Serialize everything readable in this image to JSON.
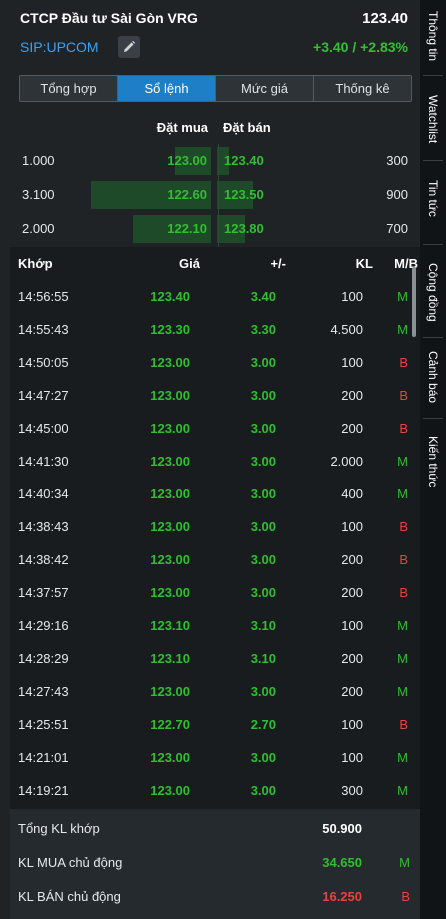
{
  "header": {
    "company": "CTCP Đầu tư Sài Gòn VRG",
    "price": "123.40",
    "ticker": "SIP:UPCOM",
    "change": "+3.40 / +2.83%"
  },
  "tabs": [
    {
      "label": "Tổng hợp"
    },
    {
      "label": "Sổ lệnh"
    },
    {
      "label": "Mức giá"
    },
    {
      "label": "Thống kê"
    }
  ],
  "orderbook": {
    "buy_label": "Đặt mua",
    "sell_label": "Đặt bán",
    "rows": [
      {
        "bid_qty": "1.000",
        "bid_price": "123.00",
        "ask_price": "123.40",
        "ask_qty": "300"
      },
      {
        "bid_qty": "3.100",
        "bid_price": "122.60",
        "ask_price": "123.50",
        "ask_qty": "900"
      },
      {
        "bid_qty": "2.000",
        "bid_price": "122.10",
        "ask_price": "123.80",
        "ask_qty": "700"
      }
    ],
    "bid_depth": [
      0.3,
      1.0,
      0.65
    ],
    "ask_depth": [
      0.1,
      0.3,
      0.23
    ]
  },
  "trades": {
    "headers": {
      "time": "Khớp",
      "price": "Giá",
      "change": "+/-",
      "volume": "KL",
      "side": "M/B"
    },
    "rows": [
      {
        "time": "14:56:55",
        "price": "123.40",
        "change": "3.40",
        "volume": "100",
        "side": "M"
      },
      {
        "time": "14:55:43",
        "price": "123.30",
        "change": "3.30",
        "volume": "4.500",
        "side": "M"
      },
      {
        "time": "14:50:05",
        "price": "123.00",
        "change": "3.00",
        "volume": "100",
        "side": "B"
      },
      {
        "time": "14:47:27",
        "price": "123.00",
        "change": "3.00",
        "volume": "200",
        "side": "B"
      },
      {
        "time": "14:45:00",
        "price": "123.00",
        "change": "3.00",
        "volume": "200",
        "side": "B"
      },
      {
        "time": "14:41:30",
        "price": "123.00",
        "change": "3.00",
        "volume": "2.000",
        "side": "M"
      },
      {
        "time": "14:40:34",
        "price": "123.00",
        "change": "3.00",
        "volume": "400",
        "side": "M"
      },
      {
        "time": "14:38:43",
        "price": "123.00",
        "change": "3.00",
        "volume": "100",
        "side": "B"
      },
      {
        "time": "14:38:42",
        "price": "123.00",
        "change": "3.00",
        "volume": "200",
        "side": "B"
      },
      {
        "time": "14:37:57",
        "price": "123.00",
        "change": "3.00",
        "volume": "200",
        "side": "B"
      },
      {
        "time": "14:29:16",
        "price": "123.10",
        "change": "3.10",
        "volume": "100",
        "side": "M"
      },
      {
        "time": "14:28:29",
        "price": "123.10",
        "change": "3.10",
        "volume": "200",
        "side": "M"
      },
      {
        "time": "14:27:43",
        "price": "123.00",
        "change": "3.00",
        "volume": "200",
        "side": "M"
      },
      {
        "time": "14:25:51",
        "price": "122.70",
        "change": "2.70",
        "volume": "100",
        "side": "B"
      },
      {
        "time": "14:21:01",
        "price": "123.00",
        "change": "3.00",
        "volume": "100",
        "side": "M"
      },
      {
        "time": "14:19:21",
        "price": "123.00",
        "change": "3.00",
        "volume": "300",
        "side": "M"
      }
    ]
  },
  "summary": {
    "total_label": "Tổng KL khớp",
    "total_value": "50.900",
    "buy_label": "KL MUA chủ động",
    "buy_value": "34.650",
    "buy_tag": "M",
    "sell_label": "KL BÁN chủ động",
    "sell_value": "16.250",
    "sell_tag": "B"
  },
  "side_tabs": [
    "Thông tin",
    "Watchlist",
    "Tin tức",
    "Cộng đồng",
    "Cảnh báo",
    "Kiến thức"
  ],
  "colors": {
    "up": "#2fbf2f",
    "down": "#e8443a",
    "accent": "#1e7fc6",
    "ticker": "#3ea0f0"
  },
  "icons": {
    "edit": "pencil-icon"
  }
}
